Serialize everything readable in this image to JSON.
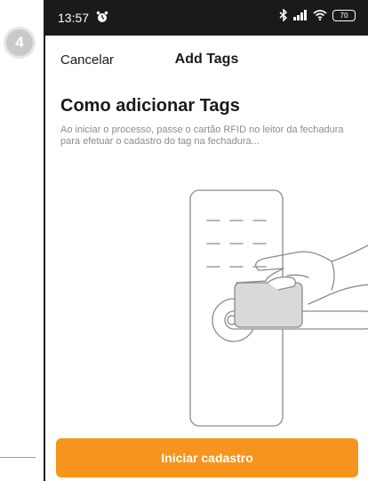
{
  "step": {
    "number": "4"
  },
  "status_bar": {
    "time": "13:57",
    "battery": "70",
    "icons": [
      "alarm-clock-icon",
      "bluetooth-icon",
      "signal-icon",
      "wifi-icon",
      "battery-icon"
    ]
  },
  "nav": {
    "cancel_label": "Cancelar",
    "title": "Add Tags"
  },
  "main": {
    "heading": "Como adicionar Tags",
    "description": "Ao iniciar o processo, passe o cartão RFID no leitor da fechadura para efetuar o cadastro do tag na fechadura..."
  },
  "cta": {
    "label": "Iniciar cadastro"
  },
  "colors": {
    "accent": "#f7941d",
    "status_bar": "#1a1a1a",
    "text_muted": "#8c8c8c",
    "card_fill": "#d9d9d9"
  },
  "illustration": {
    "icon": "hand-holding-rfid-card-at-lock-icon"
  }
}
